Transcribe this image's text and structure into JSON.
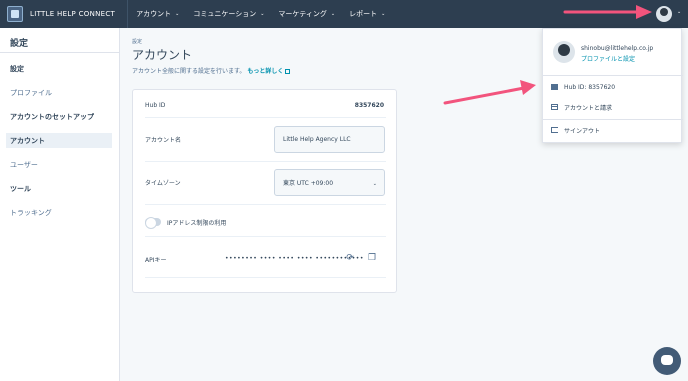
{
  "topnav": {
    "brand": "LITTLE HELP CONNECT",
    "items": [
      {
        "label": "アカウント"
      },
      {
        "label": "コミュニケーション"
      },
      {
        "label": "マーケティング"
      },
      {
        "label": "レポート"
      }
    ],
    "caret": "⌄"
  },
  "sidebar": {
    "title": "設定",
    "items": [
      {
        "label": "設定"
      },
      {
        "label": "プロファイル"
      },
      {
        "label": "アカウントのセットアップ"
      },
      {
        "label": "アカウント"
      },
      {
        "label": "ユーザー"
      },
      {
        "label": "ツール"
      },
      {
        "label": "トラッキング"
      }
    ]
  },
  "main": {
    "crumb": "設定",
    "title": "アカウント",
    "desc": "アカウント全般に関する設定を行います。",
    "more_link": "もっと詳しく"
  },
  "card": {
    "hubid_label": "Hub ID",
    "hubid_value": "8357620",
    "account_name_label": "アカウント名",
    "account_name_value": "Little Help Agency LLC",
    "timezone_label": "タイムゾーン",
    "timezone_value": "東京 UTC +09:00",
    "ip_toggle_label": "IPアドレス制限の利用",
    "api_label": "APIキー",
    "api_masked": "•••••••• •••• •••• •••• ••••••••••••"
  },
  "dropdown": {
    "email": "shinobu@littlehelp.co.jp",
    "profile_link": "プロファイルと設定",
    "hub_id": "Hub ID: 8357620",
    "billing": "アカウントと請求",
    "signout": "サインアウト"
  },
  "colors": {
    "nav_bg": "#2d3e50",
    "link": "#0091ae",
    "arrow": "#f2547d"
  }
}
